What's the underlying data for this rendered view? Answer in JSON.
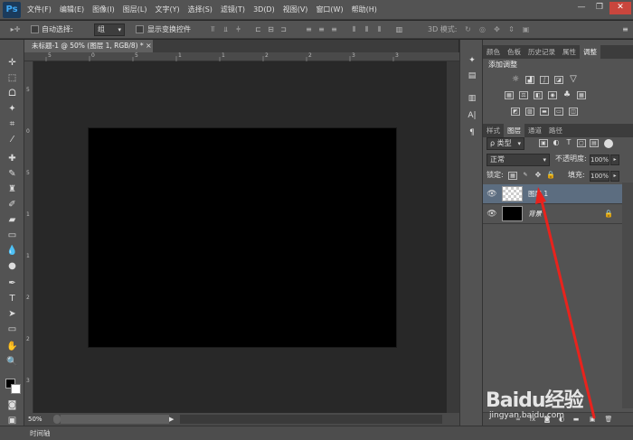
{
  "app": {
    "logo": "Ps"
  },
  "menu": [
    "文件(F)",
    "编辑(E)",
    "图像(I)",
    "图层(L)",
    "文字(Y)",
    "选择(S)",
    "滤镜(T)",
    "3D(D)",
    "视图(V)",
    "窗口(W)",
    "帮助(H)"
  ],
  "window_buttons": {
    "minimize": "—",
    "restore": "❐",
    "close": "✕"
  },
  "options": {
    "auto_select_label": "自动选择:",
    "auto_select_value": "组",
    "show_transform_label": "显示变换控件",
    "mode_3d_label": "3D 模式:"
  },
  "document": {
    "tab_title": "未标题-1 @ 50% (图层 1, RGB/8) *",
    "tab_close": "×"
  },
  "status": {
    "zoom": "50%"
  },
  "timeline": {
    "label": "时间轴"
  },
  "ruler_marks": {
    "top": [
      "5",
      "0",
      "5",
      "1",
      "1",
      "2",
      "2",
      "3",
      "3"
    ],
    "left": [
      "5",
      "0",
      "5",
      "1",
      "1",
      "2",
      "2",
      "3",
      "3"
    ]
  },
  "panels": {
    "top_tabs": [
      "颜色",
      "色板",
      "历史记录",
      "属性",
      "调整"
    ],
    "top_active": "调整",
    "adjust_title": "添加调整",
    "layer_tabs": [
      "样式",
      "图层",
      "通道",
      "路径"
    ],
    "layer_active": "图层",
    "filter_kind": "ρ 类型",
    "blend_mode": "正常",
    "opacity_label": "不透明度:",
    "opacity_value": "100%",
    "lock_label": "锁定:",
    "fill_label": "填充:",
    "fill_value": "100%"
  },
  "layers": [
    {
      "name": "图层 1",
      "selected": true
    },
    {
      "name": "背景",
      "selected": false
    }
  ],
  "watermark": {
    "brand": "Baidu经验",
    "url": "jingyan.baidu.com"
  },
  "colors": {
    "annotation_arrow": "#e8231d",
    "selected_layer": "#5c6d80"
  }
}
